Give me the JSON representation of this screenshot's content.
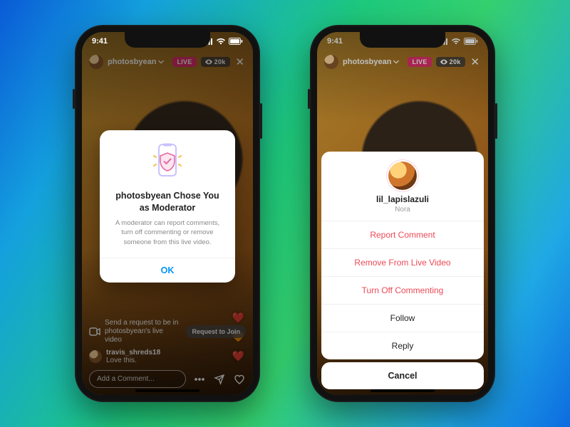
{
  "status": {
    "time": "9:41"
  },
  "common": {
    "username": "photosbyean",
    "live_label": "LIVE",
    "viewer_count": "20k"
  },
  "left": {
    "modal": {
      "title": "photosbyean Chose You as Moderator",
      "desc": "A moderator can report comments, turn off commenting or remove someone from this live video.",
      "ok": "OK"
    },
    "request_line": "Send a request to be in photosbyean's live video",
    "request_btn": "Request to Join",
    "comment_user": "travis_shreds18",
    "comment_text": "Love this.",
    "input_placeholder": "Add a Comment..."
  },
  "right": {
    "sheet": {
      "username": "lil_lapislazuli",
      "display_name": "Nora",
      "items": [
        {
          "label": "Report Comment",
          "kind": "danger"
        },
        {
          "label": "Remove From Live Video",
          "kind": "danger"
        },
        {
          "label": "Turn Off Commenting",
          "kind": "danger"
        },
        {
          "label": "Follow",
          "kind": "normal"
        },
        {
          "label": "Reply",
          "kind": "normal"
        }
      ],
      "cancel": "Cancel"
    }
  }
}
